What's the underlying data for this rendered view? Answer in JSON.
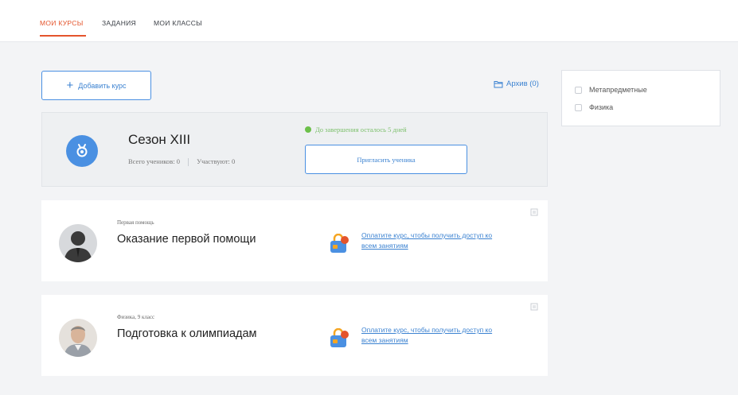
{
  "tabs": [
    {
      "label": "МОИ КУРСЫ",
      "active": true
    },
    {
      "label": "ЗАДАНИЯ",
      "active": false
    },
    {
      "label": "МОИ КЛАССЫ",
      "active": false
    }
  ],
  "toolbar": {
    "add_course_label": "Добавить курс",
    "archive_label": "Архив (0)"
  },
  "filters": [
    {
      "label": "Метапредметные",
      "checked": false
    },
    {
      "label": "Физика",
      "checked": false
    }
  ],
  "season": {
    "title": "Сезон XIII",
    "total_students": "Всего учеников: 0",
    "participating": "Участвуют: 0",
    "deadline": "До завершения осталось 5 дней",
    "invite_label": "Пригласить ученика"
  },
  "courses": [
    {
      "subject": "Первая помощь",
      "title": "Оказание первой помощи",
      "pay_link": "Оплатите курс, чтобы получить доступ ко всем занятиям"
    },
    {
      "subject": "Физика, 9 класс",
      "title": "Подготовка к олимпиадам",
      "pay_link": "Оплатите курс, чтобы получить доступ ко всем занятиям"
    }
  ],
  "colors": {
    "accent": "#e4542c",
    "link": "#3b82d1",
    "success": "#6cc04a"
  }
}
